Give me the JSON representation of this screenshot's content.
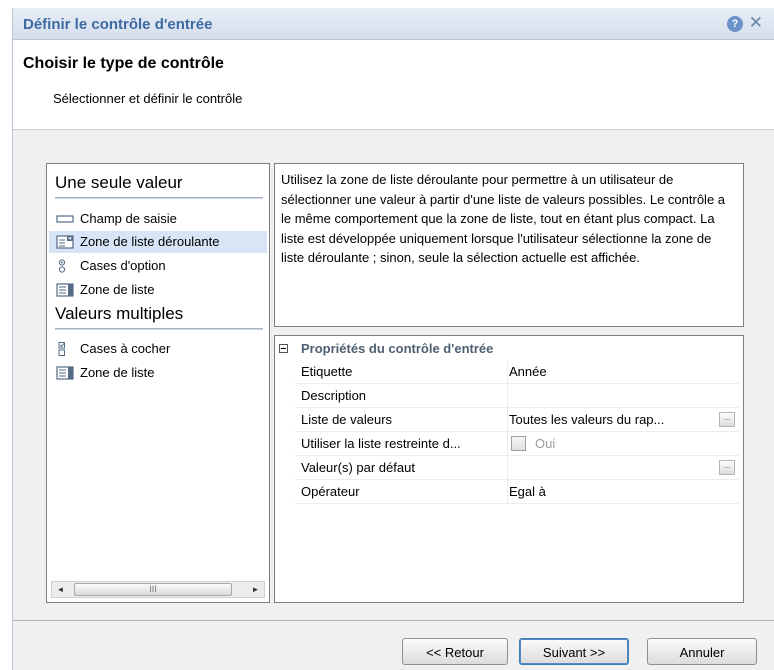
{
  "dialog": {
    "title": "Définir le contrôle d'entrée",
    "help_glyph": "?",
    "close_glyph": "✕"
  },
  "header": {
    "title": "Choisir le type de contrôle",
    "subtitle": "Sélectionner et définir le contrôle"
  },
  "control_list": {
    "sections": [
      {
        "title": "Une seule valeur",
        "items": [
          {
            "label": "Champ de saisie",
            "icon": "text-field-icon"
          },
          {
            "label": "Zone de liste déroulante",
            "icon": "dropdown-list-icon",
            "selected": true
          },
          {
            "label": "Cases d'option",
            "icon": "radio-buttons-icon"
          },
          {
            "label": "Zone de liste",
            "icon": "list-box-icon"
          }
        ]
      },
      {
        "title": "Valeurs multiples",
        "items": [
          {
            "label": "Cases à cocher",
            "icon": "checkboxes-icon"
          },
          {
            "label": "Zone de liste",
            "icon": "list-box-icon"
          }
        ]
      }
    ],
    "scroll_thumb_glyph": "III",
    "scroll_left_glyph": "◄",
    "scroll_right_glyph": "►"
  },
  "description": "Utilisez la zone de liste déroulante pour permettre à un utilisateur de sélectionner une valeur à partir d'une liste de valeurs possibles. Le contrôle a le même comportement que la zone de liste, tout en étant plus compact. La liste est développée uniquement lorsque l'utilisateur sélectionne la zone de liste déroulante ; sinon, seule la sélection actuelle est affichée.",
  "properties": {
    "header": "Propriétés du contrôle d'entrée",
    "rows": [
      {
        "name": "Etiquette",
        "value": "Année"
      },
      {
        "name": "Description",
        "value": ""
      },
      {
        "name": "Liste de valeurs",
        "value": "Toutes les valeurs du rap...",
        "ellipsis": "..."
      },
      {
        "name": "Utiliser la liste restreinte d...",
        "value": "Oui",
        "checkbox": true,
        "checked": false
      },
      {
        "name": "Valeur(s) par défaut",
        "value": "",
        "ellipsis": "..."
      },
      {
        "name": "Opérateur",
        "value": "Egal à"
      }
    ]
  },
  "buttons": {
    "back": "<< Retour",
    "next": "Suivant >>",
    "cancel": "Annuler"
  }
}
